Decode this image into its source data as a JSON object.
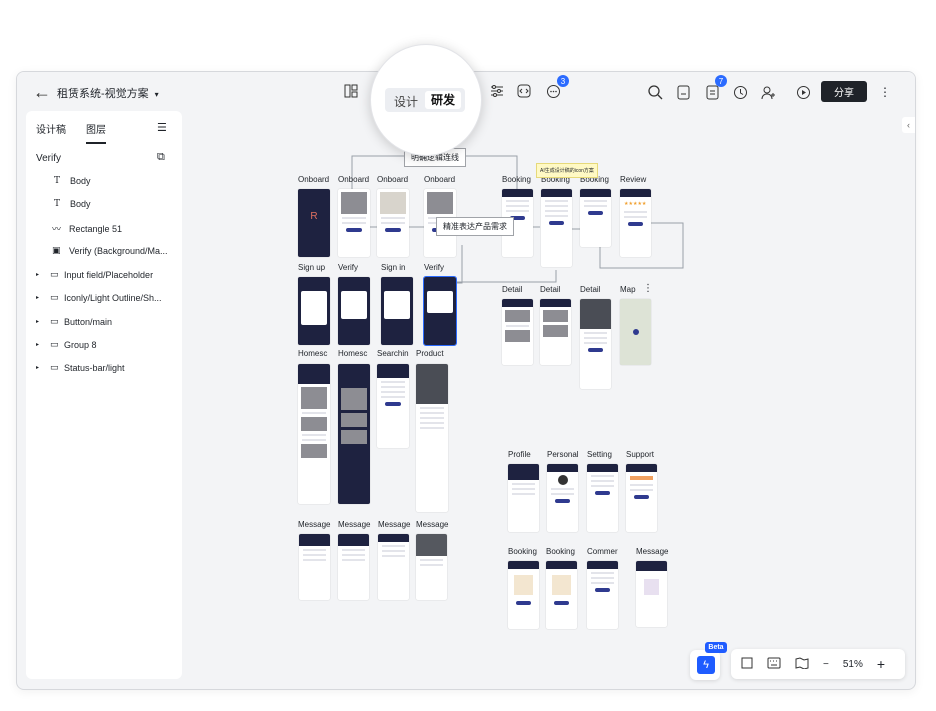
{
  "topbar": {
    "title": "租赁系统-视觉方案",
    "share_label": "分享",
    "comments_badge": "3",
    "notifications_badge": "7"
  },
  "mode_switch": {
    "design": "设计",
    "dev": "研发"
  },
  "panel": {
    "tabs": [
      "设计稿",
      "图层"
    ],
    "active_tab": "图层",
    "root": "Verify",
    "layers": [
      {
        "icon": "text-icon",
        "label": "Body"
      },
      {
        "icon": "text-icon",
        "label": "Body"
      },
      {
        "icon": "vector-icon",
        "label": "Rectangle 51"
      },
      {
        "icon": "image-icon",
        "label": "Verify (Background/Ma..."
      },
      {
        "icon": "folder-icon",
        "label": "Input field/Placeholder"
      },
      {
        "icon": "folder-icon",
        "label": "Iconly/Light Outline/Sh..."
      },
      {
        "icon": "folder-icon",
        "label": "Button/main"
      },
      {
        "icon": "folder-icon",
        "label": "Group 8"
      },
      {
        "icon": "folder-icon",
        "label": "Status-bar/light"
      }
    ]
  },
  "canvas": {
    "labels": {
      "onboard": "Onboard",
      "signup": "Sign up",
      "verify": "Verify",
      "signin": "Sign in",
      "homesc": "Homesc",
      "searching": "Searchin",
      "product": "Product",
      "message": "Message",
      "booking": "Booking",
      "review": "Review",
      "detail": "Detail",
      "map": "Map",
      "profile": "Profile",
      "personal": "Personal",
      "setting": "Setting",
      "support": "Support",
      "comment": "Commer"
    },
    "callout_links": "明确逻辑连线",
    "callout_needs": "精准表达产品需求",
    "sticky_note": "AI生成设计稿的icon方案"
  },
  "zoom": {
    "level": "51%",
    "minus": "−",
    "plus": "+"
  },
  "ai_badge": "Beta"
}
